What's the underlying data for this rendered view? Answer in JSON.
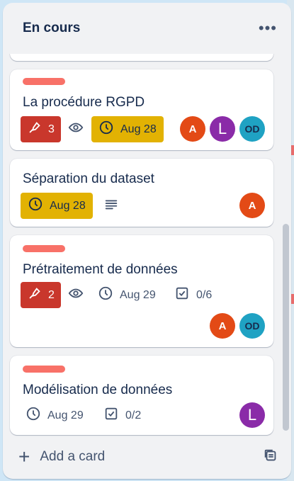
{
  "list": {
    "title": "En cours",
    "menu_icon": "ellipsis-icon",
    "add_card_label": "Add a card"
  },
  "cards": [
    {
      "title": "La procédure RGPD",
      "has_label": true,
      "label_color": "#f87168",
      "attachments": "3",
      "watching": true,
      "due": "Aug 28",
      "members": [
        "A",
        "L",
        "OD"
      ]
    },
    {
      "title": "Séparation du dataset",
      "has_label": false,
      "due": "Aug 28",
      "has_description": true,
      "members": [
        "A"
      ]
    },
    {
      "title": "Prétraitement de données",
      "has_label": true,
      "label_color": "#f87168",
      "attachments": "2",
      "watching": true,
      "due": "Aug 29",
      "checklist": "0/6",
      "members": [
        "A",
        "OD"
      ]
    },
    {
      "title": "Modélisation de données",
      "has_label": true,
      "label_color": "#f87168",
      "due": "Aug 29",
      "checklist": "0/2",
      "members": [
        "L"
      ]
    }
  ],
  "colors": {
    "label_red": "#f87168",
    "badge_red": "#c9372c",
    "badge_yellow": "#e2b203",
    "avatar_a": "#e34a16",
    "avatar_l": "#8a2ba8",
    "avatar_od": "#1fa2c3"
  }
}
